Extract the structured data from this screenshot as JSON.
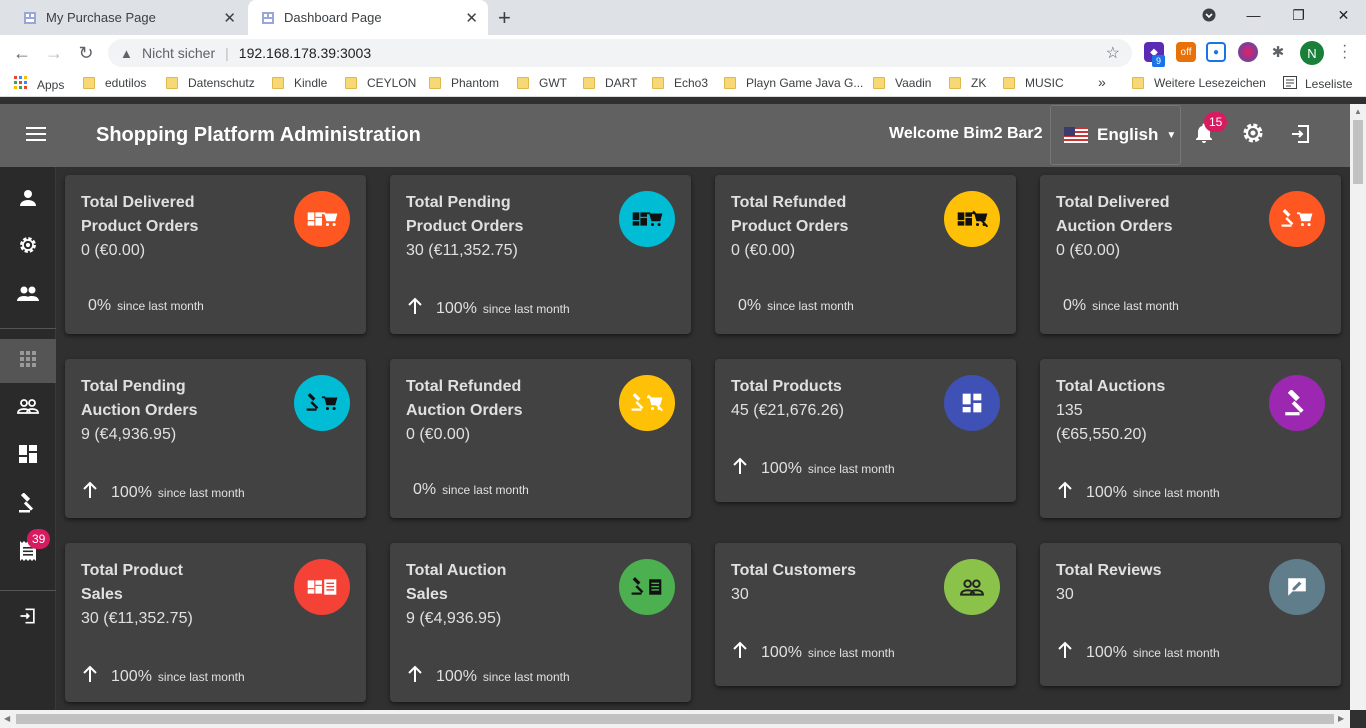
{
  "browser": {
    "tabs": [
      {
        "title": "My Purchase Page",
        "active": false
      },
      {
        "title": "Dashboard Page",
        "active": true
      }
    ],
    "address": {
      "security": "Nicht sicher",
      "url": "192.168.178.39:3003"
    },
    "extensions": {
      "badge_count": "9",
      "off_label": "off",
      "profile_initial": "N"
    },
    "bookmarks": [
      {
        "label": "Apps",
        "type": "apps"
      },
      {
        "label": "edutilos",
        "type": "folder"
      },
      {
        "label": "Datenschutz",
        "type": "folder"
      },
      {
        "label": "Kindle",
        "type": "folder"
      },
      {
        "label": "CEYLON",
        "type": "folder"
      },
      {
        "label": "Phantom",
        "type": "folder"
      },
      {
        "label": "GWT",
        "type": "folder"
      },
      {
        "label": "DART",
        "type": "folder"
      },
      {
        "label": "Echo3",
        "type": "folder"
      },
      {
        "label": "Playn Game Java G...",
        "type": "folder"
      },
      {
        "label": "Vaadin",
        "type": "folder"
      },
      {
        "label": "ZK",
        "type": "folder"
      },
      {
        "label": "MUSIC",
        "type": "folder"
      }
    ],
    "more_bookmarks": "»",
    "other_bookmarks": "Weitere Lesezeichen",
    "reading_list": "Leseliste"
  },
  "app": {
    "title": "Shopping Platform Administration",
    "welcome": "Welcome Bim2 Bar2",
    "language": "English",
    "notifications_count": "15",
    "sidebar_badge": "39"
  },
  "cards": [
    {
      "title_l1": "Total Delivered",
      "title_l2": "Product Orders",
      "values": [
        "0 (€0.00)"
      ],
      "trend": "none",
      "pct": "0%",
      "since": "since last month",
      "color": "#ff5722",
      "icon": "product-cart-icon"
    },
    {
      "title_l1": "Total Pending",
      "title_l2": "Product Orders",
      "values": [
        "30 (€11,352.75)"
      ],
      "trend": "up",
      "pct": "100%",
      "since": "since last month",
      "color": "#00bcd4",
      "icon": "product-cart-pending-icon"
    },
    {
      "title_l1": "Total Refunded",
      "title_l2": "Product Orders",
      "values": [
        "0 (€0.00)"
      ],
      "trend": "none",
      "pct": "0%",
      "since": "since last month",
      "color": "#ffc107",
      "icon": "product-cart-refund-icon"
    },
    {
      "title_l1": "Total Delivered",
      "title_l2": "Auction Orders",
      "values": [
        "0 (€0.00)"
      ],
      "trend": "none",
      "pct": "0%",
      "since": "since last month",
      "color": "#ff5722",
      "icon": "gavel-cart-icon"
    },
    {
      "title_l1": "Total Pending",
      "title_l2": "Auction Orders",
      "values": [
        "9 (€4,936.95)"
      ],
      "trend": "up",
      "pct": "100%",
      "since": "since last month",
      "color": "#00bcd4",
      "icon": "gavel-cart-pending-icon"
    },
    {
      "title_l1": "Total Refunded",
      "title_l2": "Auction Orders",
      "values": [
        "0 (€0.00)"
      ],
      "trend": "none",
      "pct": "0%",
      "since": "since last month",
      "color": "#ffc107",
      "icon": "gavel-cart-refund-icon"
    },
    {
      "title_l1": "Total Products",
      "title_l2": "",
      "values": [
        "45 (€21,676.26)"
      ],
      "trend": "up",
      "pct": "100%",
      "since": "since last month",
      "color": "#3f51b5",
      "icon": "product-grid-icon"
    },
    {
      "title_l1": "Total Auctions",
      "title_l2": "",
      "values": [
        "135",
        "(€65,550.20)"
      ],
      "trend": "up",
      "pct": "100%",
      "since": "since last month",
      "color": "#9c27b0",
      "icon": "gavel-icon"
    },
    {
      "title_l1": "Total Product",
      "title_l2": "Sales",
      "values": [
        "30 (€11,352.75)"
      ],
      "trend": "up",
      "pct": "100%",
      "since": "since last month",
      "color": "#f44336",
      "icon": "product-receipt-icon"
    },
    {
      "title_l1": "Total Auction",
      "title_l2": "Sales",
      "values": [
        "9 (€4,936.95)"
      ],
      "trend": "up",
      "pct": "100%",
      "since": "since last month",
      "color": "#4caf50",
      "icon": "gavel-receipt-icon"
    },
    {
      "title_l1": "Total Customers",
      "title_l2": "",
      "values": [
        "30"
      ],
      "trend": "up",
      "pct": "100%",
      "since": "since last month",
      "color": "#8bc34a",
      "icon": "customers-icon"
    },
    {
      "title_l1": "Total Reviews",
      "title_l2": "",
      "values": [
        "30"
      ],
      "trend": "up",
      "pct": "100%",
      "since": "since last month",
      "color": "#607d8b",
      "icon": "review-icon"
    }
  ]
}
